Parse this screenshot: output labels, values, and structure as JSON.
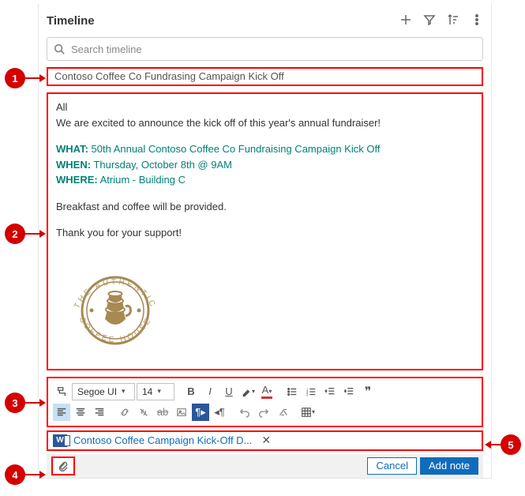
{
  "header": {
    "title": "Timeline"
  },
  "search": {
    "placeholder": "Search timeline"
  },
  "note": {
    "title": "Contoso Coffee Co Fundrasing Campaign Kick Off",
    "line_all": "All",
    "line_intro": "We are excited to announce the kick off of this year's annual fundraiser!",
    "what_label": "WHAT:",
    "what_text": " 50th Annual Contoso Coffee Co Fundraising Campaign Kick Off",
    "when_label": "WHEN:",
    "when_text": " Thursday, October 8th @ 9AM",
    "where_label": "WHERE:",
    "where_text": " Atrium - Building C",
    "line_breakfast": "Breakfast and coffee will be provided.",
    "line_thanks": "Thank you for your support!",
    "logo_top": "THE AUTHENTIC",
    "logo_bottom": "COFFEE HOUSE"
  },
  "toolbar": {
    "font_family": "Segoe UI",
    "font_size": "14"
  },
  "attachment": {
    "name": "Contoso Coffee Campaign Kick-Off D..."
  },
  "footer": {
    "cancel": "Cancel",
    "add": "Add note"
  },
  "callouts": {
    "c1": "1",
    "c2": "2",
    "c3": "3",
    "c4": "4",
    "c5": "5"
  }
}
